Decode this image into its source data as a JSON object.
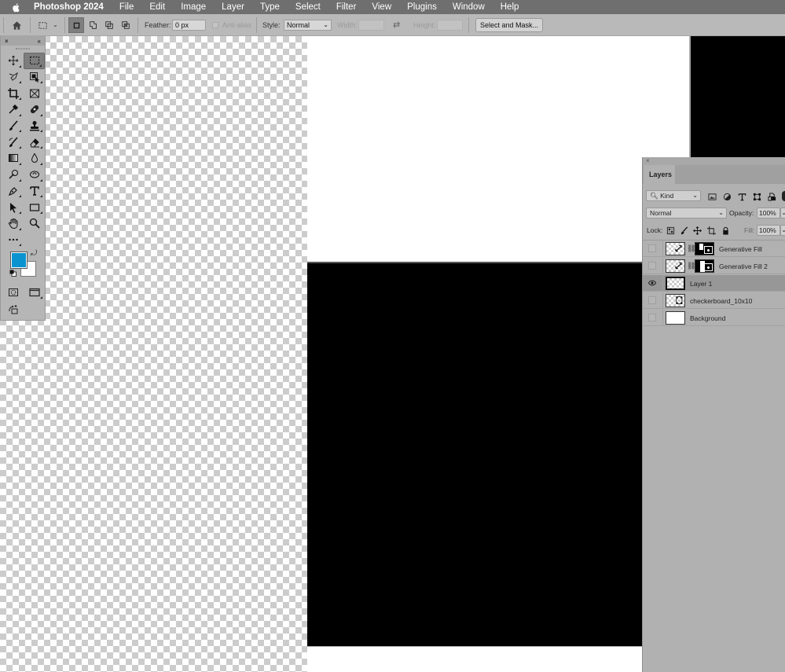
{
  "menubar": {
    "app_name": "Photoshop 2024",
    "items": [
      "File",
      "Edit",
      "Image",
      "Layer",
      "Type",
      "Select",
      "Filter",
      "View",
      "Plugins",
      "Window",
      "Help"
    ]
  },
  "options_bar": {
    "feather_label": "Feather:",
    "feather_value": "0 px",
    "anti_alias_label": "Anti-alias",
    "style_label": "Style:",
    "style_value": "Normal",
    "width_label": "Width:",
    "width_value": "",
    "height_label": "Height:",
    "height_value": "",
    "select_and_mask_label": "Select and Mask..."
  },
  "tools": {
    "close_glyph": "×",
    "collapse_glyph": "«",
    "active_tool": "rectangular-marquee",
    "foreground_color": "#0b93d0",
    "background_color": "#ffffff",
    "items": [
      "move",
      "rectangular-marquee",
      "lasso",
      "object-selection",
      "crop",
      "frame",
      "eyedropper",
      "spot-healing-brush",
      "brush",
      "clone-stamp",
      "history-brush",
      "eraser",
      "gradient",
      "blur",
      "dodge",
      "smudge",
      "pen",
      "type",
      "path-selection",
      "rectangle",
      "hand",
      "zoom",
      "edit-toolbar"
    ]
  },
  "layers_panel": {
    "close_glyph": "×",
    "tab_label": "Layers",
    "filter_kind": "Kind",
    "blend_mode": "Normal",
    "opacity_label": "Opacity:",
    "opacity_value": "100%",
    "lock_label": "Lock:",
    "fill_label": "Fill:",
    "fill_value": "100%",
    "layers": [
      {
        "name": "Generative Fill",
        "visible": false,
        "selected": false,
        "has_mask": true
      },
      {
        "name": "Generative Fill 2",
        "visible": false,
        "selected": false,
        "has_mask": true
      },
      {
        "name": "Layer 1",
        "visible": true,
        "selected": true,
        "has_mask": false
      },
      {
        "name": "checkerboard_10x10",
        "visible": false,
        "selected": false,
        "has_mask": false
      },
      {
        "name": "Background",
        "visible": false,
        "selected": false,
        "has_mask": false
      }
    ]
  }
}
